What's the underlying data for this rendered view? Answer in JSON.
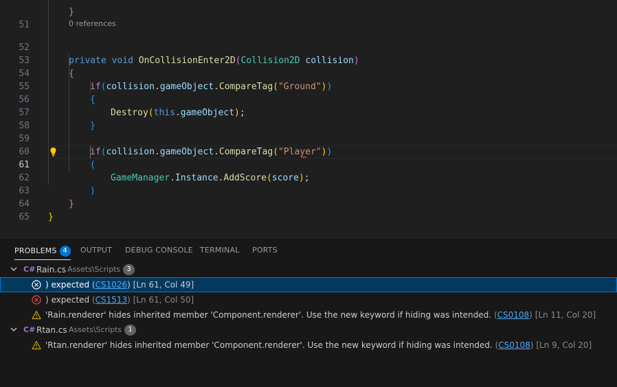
{
  "editor": {
    "codelens": "0 references",
    "line_numbers": [
      "51",
      "52",
      "53",
      "54",
      "55",
      "56",
      "57",
      "58",
      "59",
      "60",
      "61",
      "62",
      "63",
      "64",
      "65"
    ],
    "active_line": "61",
    "tokens": {
      "private": "private",
      "void": "void",
      "method": "OnCollisionEnter2D",
      "param_type": "Collision2D",
      "param_name": "collision",
      "if": "if",
      "collision": "collision",
      "gameObject": "gameObject",
      "compare": "CompareTag",
      "ground": "\"Ground\"",
      "player": "\"Player\"",
      "destroy": "Destroy",
      "this": "this",
      "game_manager": "GameManager",
      "instance": "Instance",
      "add_score": "AddScore",
      "score": "score"
    }
  },
  "panel": {
    "tabs": [
      {
        "label": "PROBLEMS",
        "badge": "4"
      },
      {
        "label": "OUTPUT"
      },
      {
        "label": "DEBUG CONSOLE"
      },
      {
        "label": "TERMINAL"
      },
      {
        "label": "PORTS"
      }
    ],
    "groups": [
      {
        "icon": "C#",
        "file": "Rain.cs",
        "path": "Assets\\Scripts",
        "count": "3",
        "items": [
          {
            "severity": "error",
            "message": ") expected",
            "code": "CS1026",
            "location": "[Ln 61, Col 49]"
          },
          {
            "severity": "error",
            "message": ") expected",
            "code": "CS1513",
            "location": "[Ln 61, Col 50]"
          },
          {
            "severity": "warning",
            "message": "'Rain.renderer' hides inherited member 'Component.renderer'. Use the new keyword if hiding was intended.",
            "code": "CS0108",
            "location": "[Ln 11, Col 20]"
          }
        ]
      },
      {
        "icon": "C#",
        "file": "Rtan.cs",
        "path": "Assets\\Scripts",
        "count": "1",
        "items": [
          {
            "severity": "warning",
            "message": "'Rtan.renderer' hides inherited member 'Component.renderer'. Use the new keyword if hiding was intended.",
            "code": "CS0108",
            "location": "[Ln 9, Col 20]"
          }
        ]
      }
    ]
  },
  "colors": {
    "background": "#1f1f1f",
    "panel_bg": "#181818",
    "selection": "#04395e",
    "accent": "#0078d4",
    "error": "#f14c4c",
    "warning": "#cca700",
    "link": "#4daafc"
  }
}
